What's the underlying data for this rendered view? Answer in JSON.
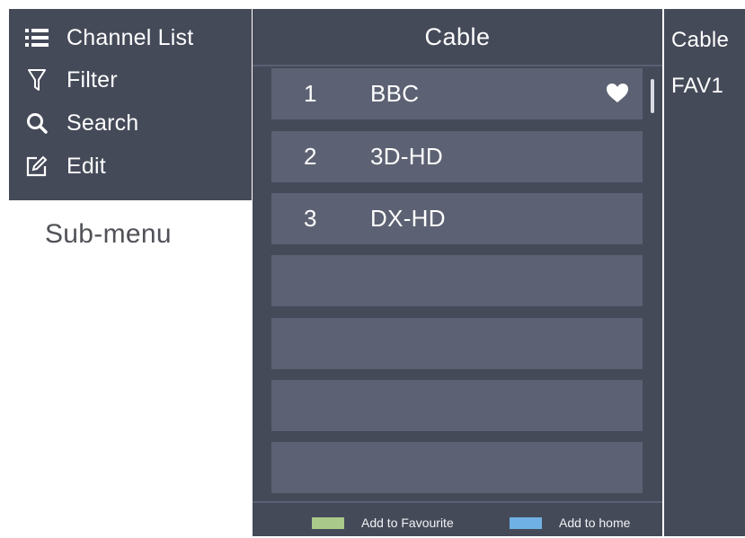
{
  "submenu": {
    "items": [
      {
        "label": "Channel List",
        "icon": "list-icon"
      },
      {
        "label": "Filter",
        "icon": "filter-icon"
      },
      {
        "label": "Search",
        "icon": "search-icon"
      },
      {
        "label": "Edit",
        "icon": "edit-icon"
      }
    ],
    "caption": "Sub-menu"
  },
  "channel_list": {
    "title": "Cable",
    "rows": [
      {
        "number": "1",
        "name": "BBC",
        "favourite": true
      },
      {
        "number": "2",
        "name": "3D-HD",
        "favourite": false
      },
      {
        "number": "3",
        "name": "DX-HD",
        "favourite": false
      },
      {
        "number": "",
        "name": "",
        "favourite": false
      },
      {
        "number": "",
        "name": "",
        "favourite": false
      },
      {
        "number": "",
        "name": "",
        "favourite": false
      },
      {
        "number": "",
        "name": "",
        "favourite": false
      }
    ],
    "footer": {
      "add_favourite_label": "Add to Favourite",
      "add_home_label": "Add to home"
    }
  },
  "list_panel": {
    "items": [
      "Cable",
      "FAV1"
    ]
  },
  "colors": {
    "panel_bg": "#454a59",
    "row_bg": "#5c6273",
    "favourite_key": "#a9c98a",
    "home_key": "#6fb1e4",
    "text": "#ffffff"
  }
}
